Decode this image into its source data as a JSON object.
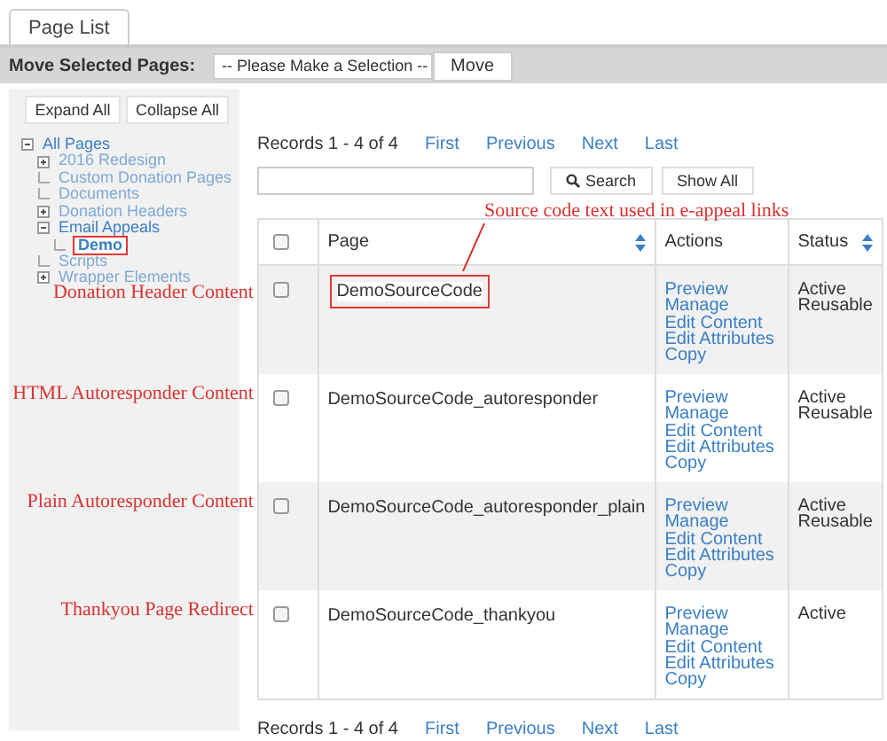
{
  "tabs": [
    {
      "label": "Page List",
      "selected": true
    }
  ],
  "move_bar": {
    "label": "Move Selected Pages:",
    "select_value": "-- Please Make a Selection --",
    "button": "Move"
  },
  "tree_buttons": [
    "Expand All",
    "Collapse All"
  ],
  "tree": [
    {
      "label": "All Pages",
      "kind": "folder",
      "expanded": true,
      "highlighted": false,
      "children": [
        {
          "label": "2016 Redesign",
          "kind": "folder",
          "expanded": false,
          "highlighted": false
        },
        {
          "label": "Custom Donation Pages",
          "kind": "page",
          "highlighted": false
        },
        {
          "label": "Documents",
          "kind": "page",
          "highlighted": false
        },
        {
          "label": "Donation Headers",
          "kind": "folder",
          "expanded": false,
          "highlighted": false
        },
        {
          "label": "Email Appeals",
          "kind": "folder",
          "expanded": true,
          "highlighted": false,
          "children": [
            {
              "label": "Demo",
              "kind": "page",
              "highlighted": true
            }
          ]
        },
        {
          "label": "Scripts",
          "kind": "page",
          "highlighted": false
        },
        {
          "label": "Wrapper Elements",
          "kind": "folder",
          "expanded": false,
          "highlighted": false
        }
      ]
    }
  ],
  "pager_top": {
    "records": "Records 1 - 4 of 4",
    "links": [
      "First",
      "Previous",
      "Next",
      "Last"
    ]
  },
  "search": {
    "button": "Search",
    "show_all": "Show All"
  },
  "table": {
    "columns": [
      {
        "label": "Page",
        "sortable": true
      },
      {
        "label": "Actions",
        "sortable": false
      },
      {
        "label": "Status",
        "sortable": true
      }
    ],
    "header_checked": false,
    "rows": [
      {
        "checked": false,
        "page": "DemoSourceCode",
        "highlighted": true,
        "actions": [
          "Preview",
          "Manage",
          "Edit Content",
          "Edit Attributes",
          "Copy"
        ],
        "status": [
          "Active",
          "Reusable"
        ]
      },
      {
        "checked": false,
        "page": "DemoSourceCode_autoresponder",
        "highlighted": false,
        "actions": [
          "Preview",
          "Manage",
          "Edit Content",
          "Edit Attributes",
          "Copy"
        ],
        "status": [
          "Active",
          "Reusable"
        ]
      },
      {
        "checked": false,
        "page": "DemoSourceCode_autoresponder_plain",
        "highlighted": false,
        "actions": [
          "Preview",
          "Manage",
          "Edit Content",
          "Edit Attributes",
          "Copy"
        ],
        "status": [
          "Active",
          "Reusable"
        ]
      },
      {
        "checked": false,
        "page": "DemoSourceCode_thankyou",
        "highlighted": false,
        "actions": [
          "Preview",
          "Manage",
          "Edit Content",
          "Edit Attributes",
          "Copy"
        ],
        "status": [
          "Active"
        ]
      }
    ]
  },
  "pager_bottom": {
    "records": "Records 1 - 4 of 4",
    "links": [
      "First",
      "Previous",
      "Next",
      "Last"
    ]
  },
  "annotations": [
    {
      "text": "Source code text used in e-appeal links",
      "kind": "callout"
    },
    {
      "text": "Donation Header Content",
      "kind": "row-label"
    },
    {
      "text": "HTML Autoresponder Content",
      "kind": "row-label"
    },
    {
      "text": "Plain Autoresponder Content",
      "kind": "row-label"
    },
    {
      "text": "Thankyou Page Redirect",
      "kind": "row-label"
    }
  ]
}
